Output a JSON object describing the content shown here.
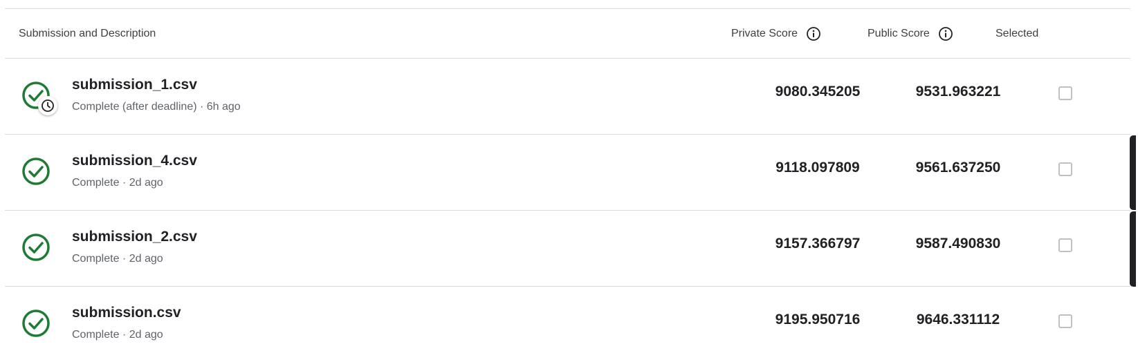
{
  "header": {
    "col_submission": "Submission and Description",
    "col_private": "Private Score",
    "col_public": "Public Score",
    "col_selected": "Selected"
  },
  "rows": [
    {
      "file": "submission_1.csv",
      "status": "Complete (after deadline) · 6h ago",
      "private_score": "9080.345205",
      "public_score": "9531.963221",
      "selected": false,
      "icon": "check-circle-icon",
      "badge_icon": "clock-icon"
    },
    {
      "file": "submission_4.csv",
      "status": "Complete · 2d ago",
      "private_score": "9118.097809",
      "public_score": "9561.637250",
      "selected": false,
      "icon": "check-circle-icon"
    },
    {
      "file": "submission_2.csv",
      "status": "Complete · 2d ago",
      "private_score": "9157.366797",
      "public_score": "9587.490830",
      "selected": false,
      "icon": "check-circle-icon"
    },
    {
      "file": "submission.csv",
      "status": "Complete · 2d ago",
      "private_score": "9195.950716",
      "public_score": "9646.331112",
      "selected": false,
      "icon": "check-circle-icon"
    }
  ],
  "colors": {
    "success": "#1e7b34",
    "text": "#202124",
    "muted": "#5f6368",
    "divider": "#dadce0"
  }
}
